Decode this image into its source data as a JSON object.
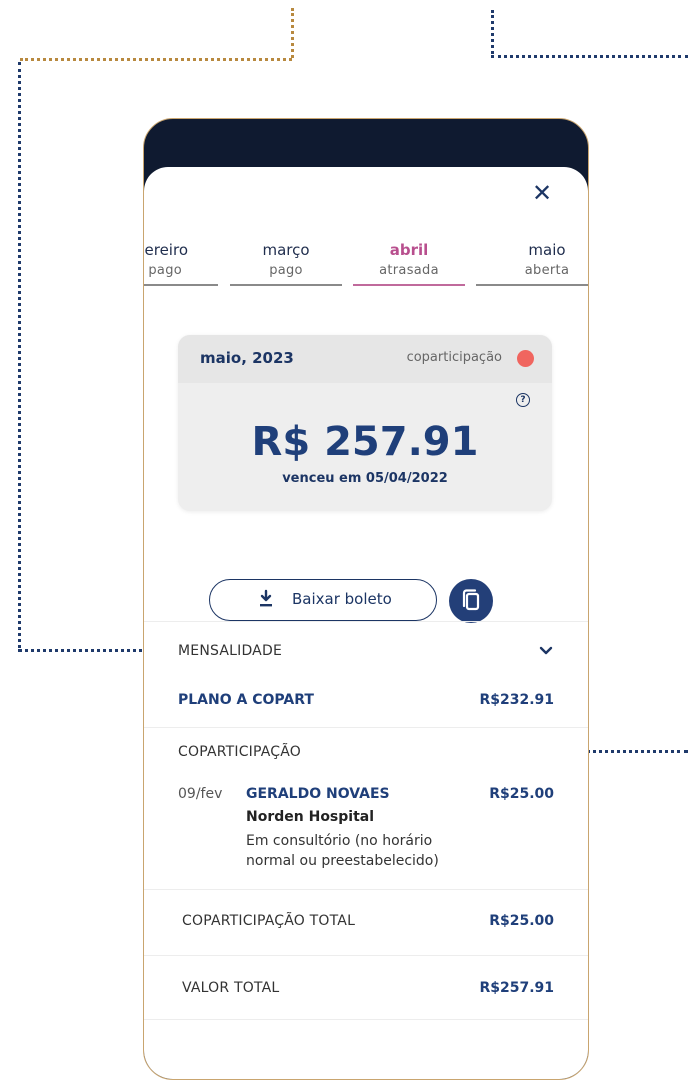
{
  "tabs": [
    {
      "month": "vereiro",
      "status": "pago"
    },
    {
      "month": "março",
      "status": "pago"
    },
    {
      "month": "abril",
      "status": "atrasada"
    },
    {
      "month": "maio",
      "status": "aberta"
    }
  ],
  "close_symbol": "✕",
  "card": {
    "date": "maio, 2023",
    "tag": "coparticipação",
    "help_symbol": "?",
    "amount": "R$ 257.91",
    "due": "venceu em 05/04/2022"
  },
  "download_label": "Baixar boleto",
  "mensalidade": {
    "label": "MENSALIDADE",
    "plan": "PLANO A COPART",
    "plan_value": "R$232.91"
  },
  "coparticipacao": {
    "label": "COPARTICIPAÇÃO",
    "date": "09/fev",
    "doctor": "GERALDO NOVAES",
    "value": "R$25.00",
    "hospital": "Norden Hospital",
    "desc_line1": "Em consultório (no horário",
    "desc_line2": "normal ou preestabelecido)"
  },
  "totals": {
    "copart_label": "COPARTICIPAÇÃO TOTAL",
    "copart_value": "R$25.00",
    "total_label": "VALOR TOTAL",
    "total_value": "R$257.91"
  },
  "colors": {
    "navy": "#1c3564",
    "accent_pink": "#b84f8e",
    "gold": "#b8893f",
    "status_red": "#f0655f"
  }
}
